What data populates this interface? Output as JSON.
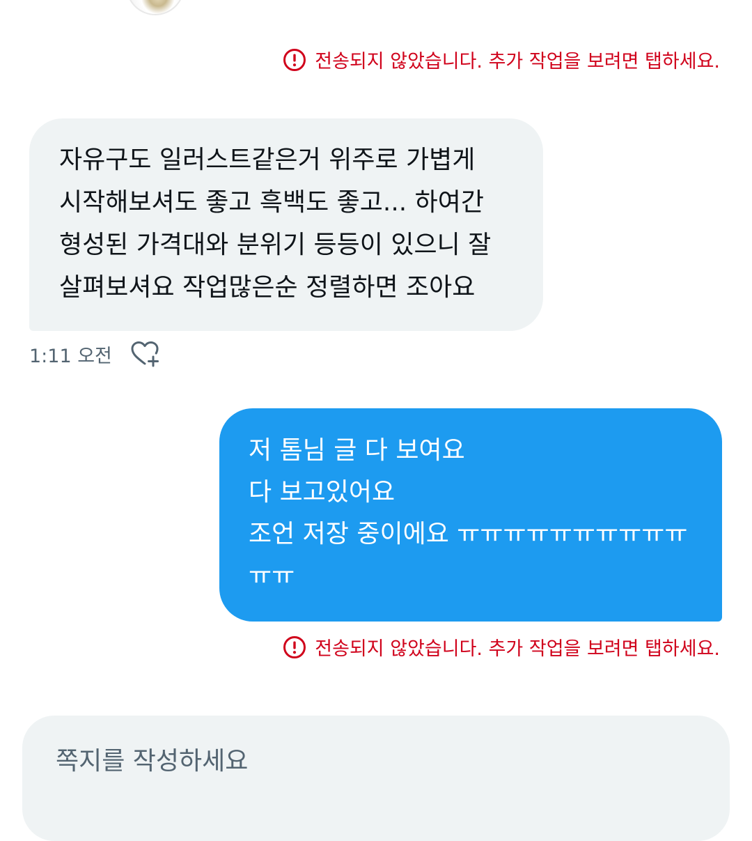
{
  "conversation": {
    "error_notice_top": "전송되지 않았습니다. 추가 작업을 보려면 탭하세요.",
    "received_message": {
      "lines": [
        "자유구도 일러스트같은거 위주로 가볍게",
        "시작해보셔도 좋고 흑백도 좋고... 하여간",
        "형성된 가격대와 분위기 등등이 있으니 잘",
        "살펴보셔요 작업많은순 정렬하면 조아요"
      ],
      "time": "1:11 오전"
    },
    "sent_message": {
      "lines": [
        "저 톰님 글 다 보여요",
        "다 보고있어요",
        "조언 저장 중이에요 ㅠㅠㅠㅠㅠㅠㅠㅠㅠㅠ",
        "ㅠㅠ"
      ]
    },
    "error_notice_bottom": "전송되지 않았습니다. 추가 작업을 보려면 탭하세요."
  },
  "composer": {
    "placeholder": "쪽지를 작성하세요"
  },
  "colors": {
    "error": "#d0021b",
    "sent_bubble": "#1d9bf0",
    "received_bubble": "#eff3f4",
    "secondary_text": "#536471"
  },
  "icons": {
    "error": "error-circle-exclamation-icon",
    "like": "heart-plus-icon"
  }
}
